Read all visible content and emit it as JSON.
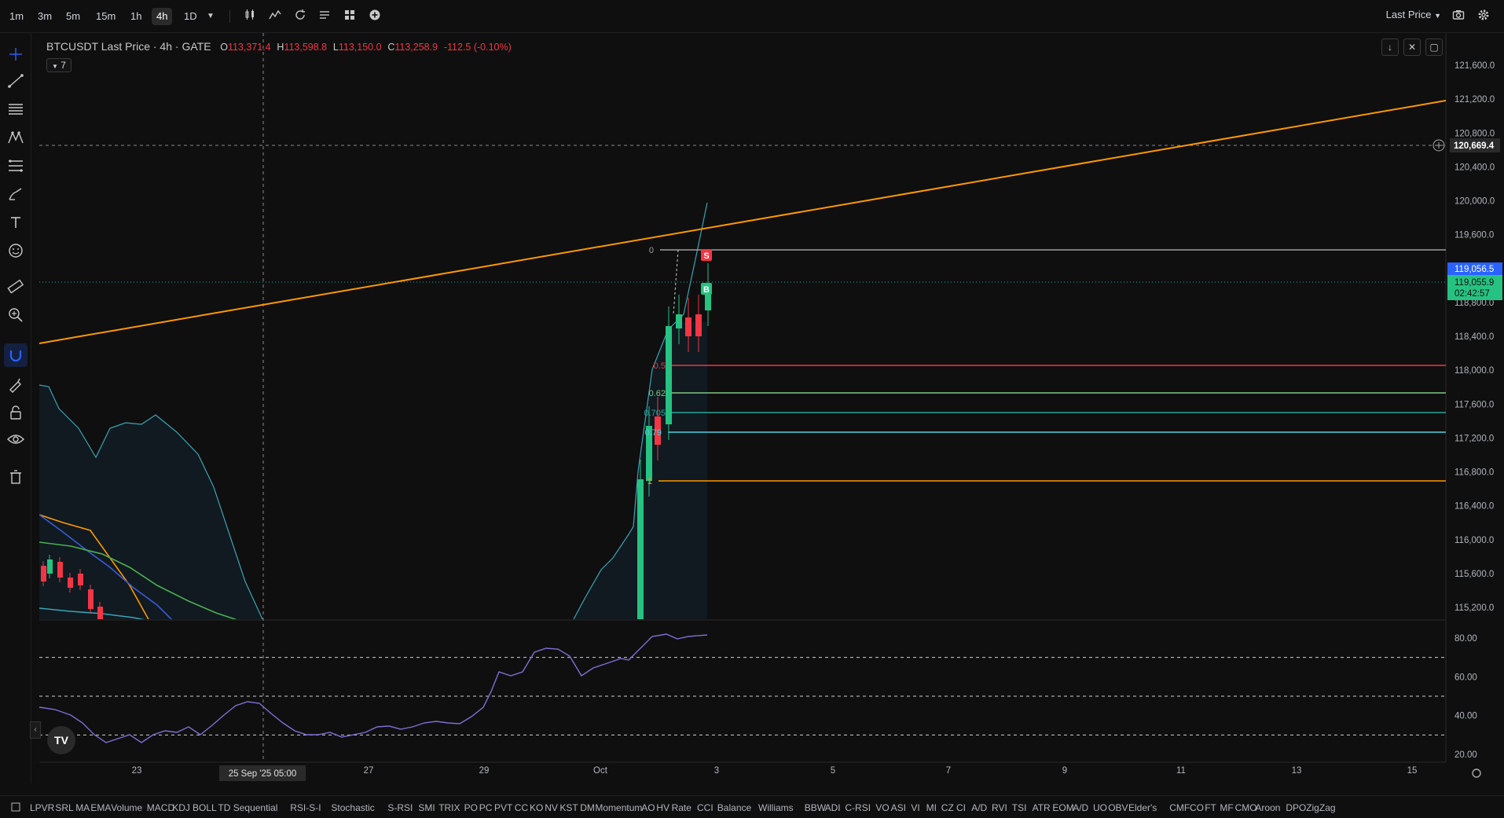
{
  "toolbar": {
    "timeframes": [
      "1m",
      "3m",
      "5m",
      "15m",
      "1h",
      "4h",
      "1D"
    ],
    "active_timeframe": "4h",
    "price_type": "Last Price"
  },
  "symbol": {
    "name": "BTCUSDT Last Price · 4h · GATE",
    "open_label": "O",
    "open": "113,371.4",
    "high_label": "H",
    "high": "113,598.8",
    "low_label": "L",
    "low": "113,150.0",
    "close_label": "C",
    "close": "113,258.9",
    "change": "-112.5 (-0.10%)",
    "indicators_count": "7"
  },
  "price_axis": {
    "ticks": [
      "121,600.0",
      "121,200.0",
      "120,800.0",
      "120,400.0",
      "120,000.0",
      "119,600.0",
      "119,200.0",
      "118,800.0",
      "118,400.0",
      "118,000.0",
      "117,600.0",
      "117,200.0",
      "116,800.0",
      "116,400.0",
      "116,000.0",
      "115,600.0",
      "115,200.0"
    ],
    "crosshair_price": "120,669.4",
    "last_price": "119,056.5",
    "current_price": "119,055.9",
    "countdown": "02:42:57"
  },
  "rsi_axis": {
    "ticks": [
      "80.00",
      "60.00",
      "40.00",
      "20.00"
    ]
  },
  "time_axis": {
    "ticks": [
      "23",
      "27",
      "29",
      "Oct",
      "3",
      "5",
      "7",
      "9",
      "11",
      "13",
      "15"
    ],
    "crosshair_time": "25 Sep '25   05:00"
  },
  "fib_levels": [
    {
      "label": "0",
      "color": "#9e9e9e"
    },
    {
      "label": "0.5",
      "color": "#f23645"
    },
    {
      "label": "0.62",
      "color": "#81c784"
    },
    {
      "label": "0.705",
      "color": "#26a69a"
    },
    {
      "label": "0.79",
      "color": "#4dd0e1"
    },
    {
      "label": "1",
      "color": "#ff9800"
    }
  ],
  "markers": {
    "sell": "S",
    "buy": "B"
  },
  "bottom_indicators": [
    "LPVR",
    "SRL",
    "MA",
    "EMA",
    "Volume",
    "MACD",
    "KDJ",
    "BOLL",
    "TD Sequential",
    "RSI-S-I",
    "Stochastic",
    "S-RSI",
    "SMI",
    "TRIX",
    "PO",
    "PC",
    "PVT",
    "CC",
    "KO",
    "NV",
    "KST",
    "DM",
    "Momentum",
    "AO",
    "HV",
    "Rate",
    "CCI",
    "Balance",
    "Williams",
    "BBW",
    "ADI",
    "C-RSI",
    "VO",
    "ASI",
    "VI",
    "MI",
    "CZ",
    "CI",
    "A/D",
    "RVI",
    "TSI",
    "ATR",
    "EOM",
    "A/D",
    "UO",
    "OBV",
    "Elder's",
    "CMF",
    "CO",
    "FT",
    "MF",
    "CMO",
    "Aroon",
    "DPO",
    "ZigZag"
  ],
  "colors": {
    "background": "#0f0f0f",
    "up": "#26c281",
    "down": "#f23645",
    "trendline": "#ff9800",
    "rsi": "#7e6fd6"
  }
}
